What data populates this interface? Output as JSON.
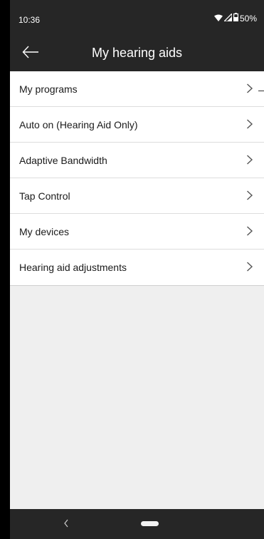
{
  "status_bar": {
    "time": "10:36",
    "battery": "50%",
    "icons": [
      "wifi-icon",
      "signal-icon",
      "battery-icon"
    ]
  },
  "app_bar": {
    "title": "My hearing aids",
    "back_icon": "arrow-left-icon"
  },
  "menu": {
    "items": [
      {
        "label": "My programs"
      },
      {
        "label": "Auto on (Hearing Aid Only)"
      },
      {
        "label": "Adaptive Bandwidth"
      },
      {
        "label": "Tap Control"
      },
      {
        "label": "My devices"
      },
      {
        "label": "Hearing aid adjustments"
      }
    ],
    "chevron_icon": "chevron-right-icon"
  },
  "nav_bar": {
    "back_icon": "nav-back-icon",
    "home_icon": "home-pill-icon"
  },
  "colors": {
    "bar_background": "#262626",
    "page_background": "#efefef",
    "list_background": "#ffffff",
    "divider": "#dddddd"
  }
}
